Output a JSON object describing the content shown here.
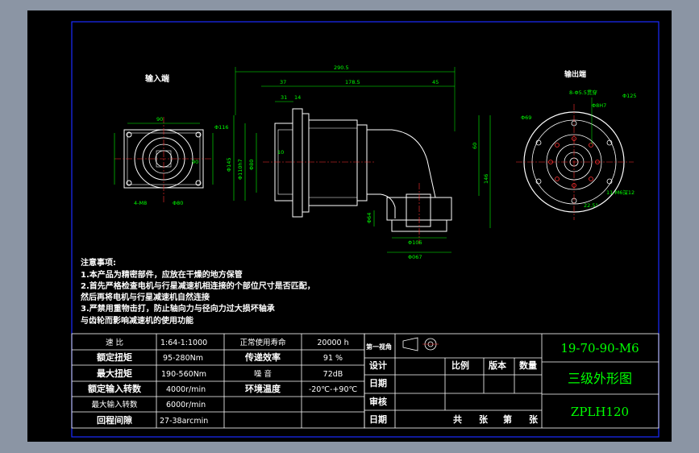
{
  "views": {
    "input_end_title": "输入端",
    "output_end_title": "输出端"
  },
  "dimensions": {
    "input": [
      "90",
      "Φ116",
      "90",
      "Φ80",
      "4-M8"
    ],
    "side": [
      "290.5",
      "178.5",
      "37",
      "31",
      "14",
      "45",
      "Φ145",
      "Φ110h7",
      "Φ80",
      "10",
      "60",
      "146",
      "Φ64",
      "Φ106",
      "Φ067"
    ],
    "output": [
      "8-Φ5.5贯穿",
      "Φ125",
      "Φ69",
      "Φ8H7",
      "11-M6深12",
      "22.5°"
    ]
  },
  "notes": {
    "heading": "注意事项:",
    "lines": [
      "1.本产品为精密部件，应放在干燥的地方保管",
      "2.首先严格检查电机与行星减速机相连接的个部位尺寸是否匹配，",
      "然后再将电机与行星减速机自然连接",
      "3.严禁用重物击打，防止轴向力与径向力过大损坏轴承",
      "与齿轮而影响减速机的使用功能"
    ]
  },
  "spec_table": [
    {
      "label": "速 比",
      "value": "1:64-1:1000",
      "label2": "正常使用寿命",
      "value2": "20000 h"
    },
    {
      "label": "额定扭矩",
      "value": "95-280Nm",
      "label2": "传递效率",
      "value2": "91 %"
    },
    {
      "label": "最大扭矩",
      "value": "190-560Nm",
      "label2": "噪 音",
      "value2": "72dB"
    },
    {
      "label": "额定输入转数",
      "value": "4000r/min",
      "label2": "环境温度",
      "value2": "-20℃-+90℃"
    },
    {
      "label": "最大输入转数",
      "value": "6000r/min",
      "label2": "",
      "value2": ""
    },
    {
      "label": "回程间隙",
      "value": "27-38arcmin",
      "label2": "",
      "value2": ""
    }
  ],
  "title_block": {
    "projection_label": "第一视角",
    "design_label": "设计",
    "date_label": "日期",
    "review_label": "审核",
    "date_label_2": "日期",
    "scale_label": "比例",
    "version_label": "版本",
    "quantity_label": "数量",
    "sheets": [
      "共",
      "张",
      "第",
      "张"
    ],
    "drawing_number": "19-70-90-M6",
    "drawing_title": "三级外形图",
    "model": "ZPLH120"
  },
  "colors": {
    "background": "#8b95a4",
    "paper": "#000000",
    "outline": "#ffffff",
    "dimension": "#00ff00",
    "frame_blue": "#1a2bff",
    "center_line": "#ff3030",
    "title_text": "#00ff00"
  }
}
